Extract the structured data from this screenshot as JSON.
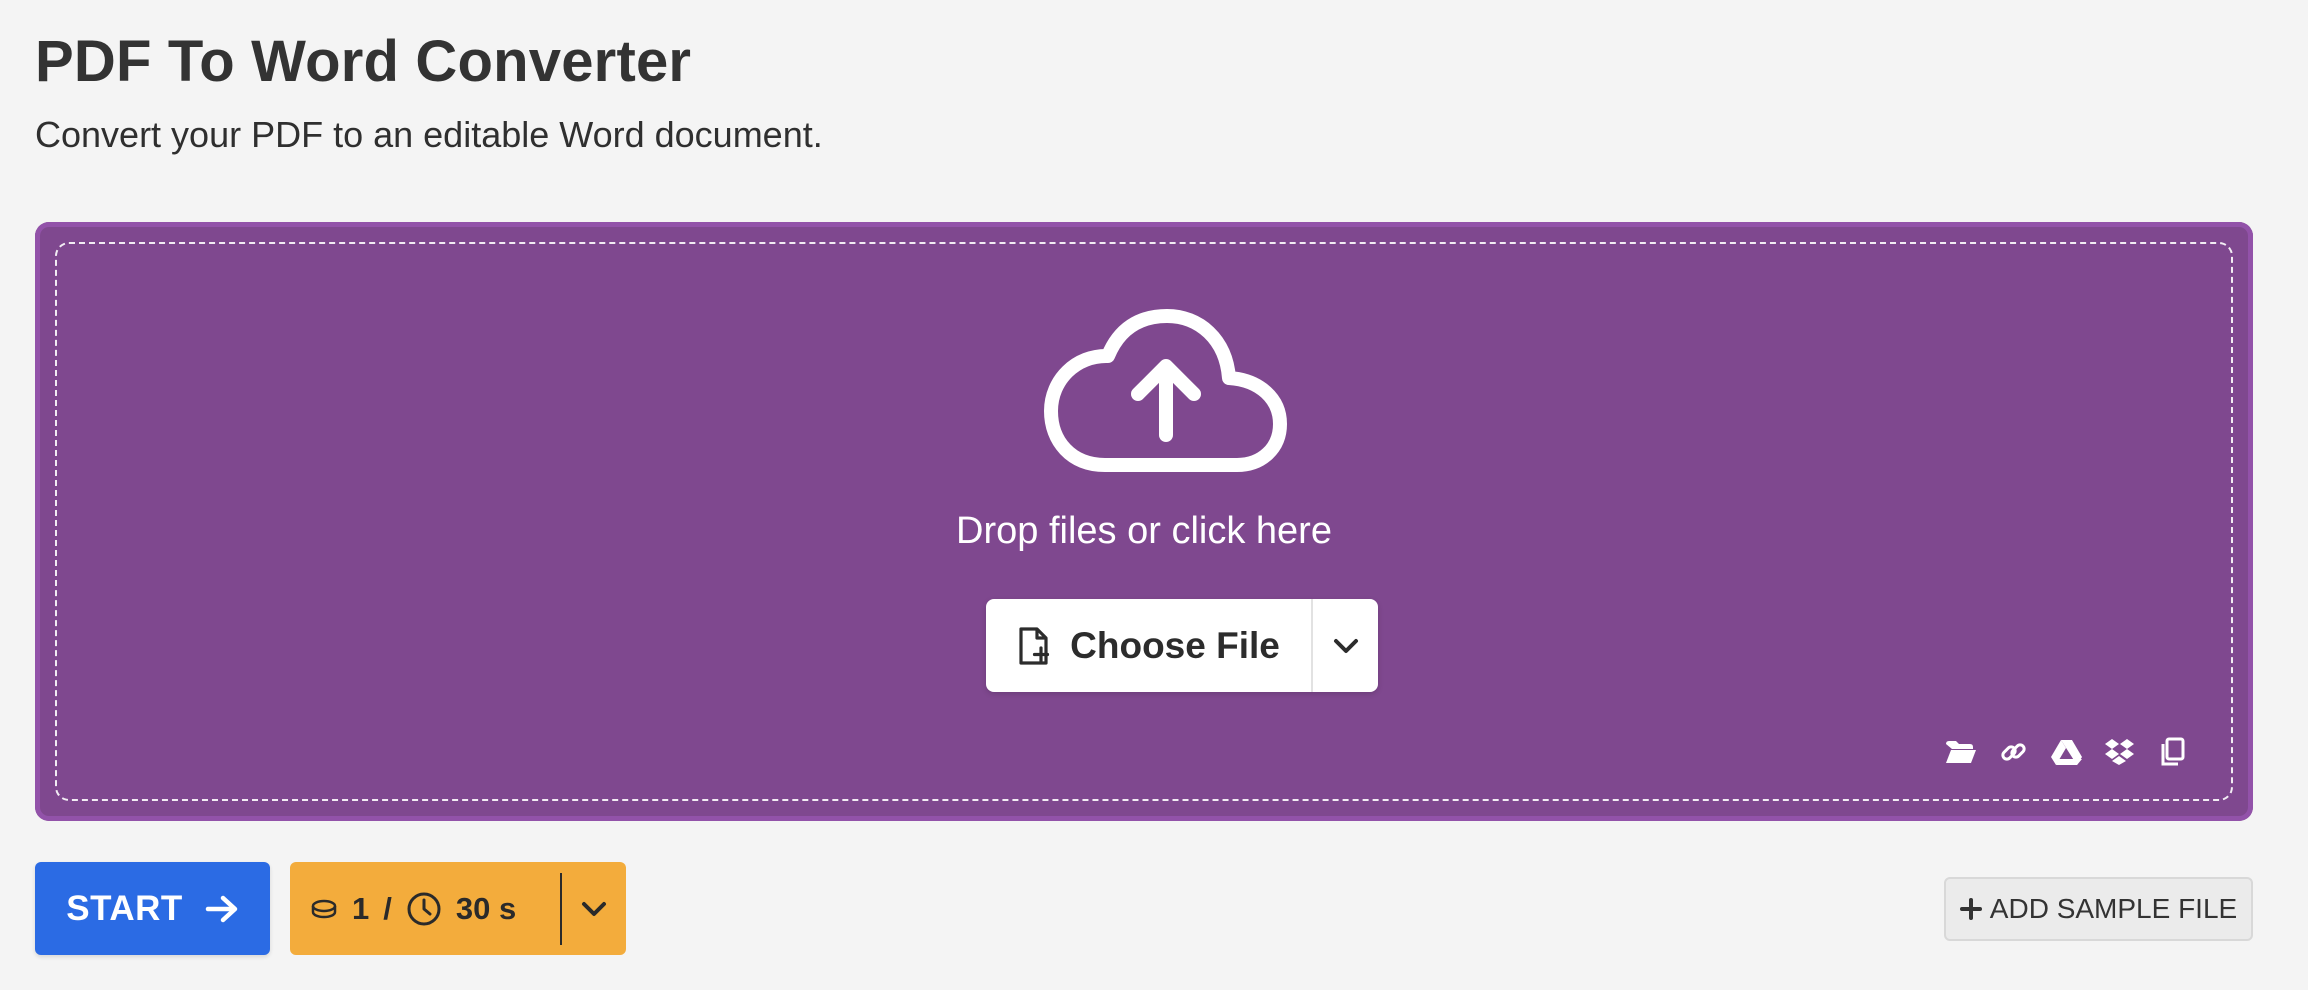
{
  "page": {
    "title": "PDF To Word Converter",
    "subtitle": "Convert your PDF to an editable Word document."
  },
  "upload": {
    "drop_text": "Drop files or click here",
    "choose_file_label": "Choose File",
    "panel_color": "#7f488f",
    "cloud_icon": "cloud-upload-icon",
    "source_icons": [
      "folder-open-icon",
      "link-icon",
      "google-drive-icon",
      "dropbox-icon",
      "clipboard-icon"
    ]
  },
  "actions": {
    "start_label": "START",
    "start_color": "#2b6be4",
    "credits": {
      "count": "1",
      "separator": "/",
      "time": "30 s",
      "color": "#f3ac3c"
    },
    "add_sample_label": "ADD SAMPLE FILE"
  }
}
